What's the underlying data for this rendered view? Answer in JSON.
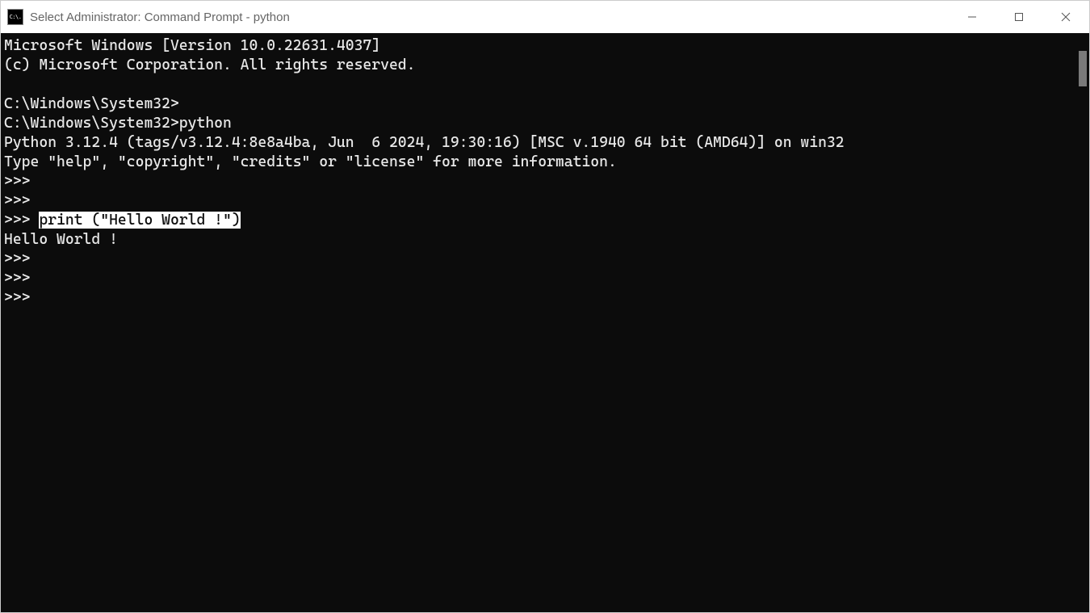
{
  "titlebar": {
    "icon_text": "C:\\.",
    "title": "Select Administrator: Command Prompt - python"
  },
  "terminal": {
    "lines": [
      {
        "text": "Microsoft Windows [Version 10.0.22631.4037]"
      },
      {
        "text": "(c) Microsoft Corporation. All rights reserved."
      },
      {
        "text": ""
      },
      {
        "text": "C:\\Windows\\System32>"
      },
      {
        "text": "C:\\Windows\\System32>python"
      },
      {
        "text": "Python 3.12.4 (tags/v3.12.4:8e8a4ba, Jun  6 2024, 19:30:16) [MSC v.1940 64 bit (AMD64)] on win32"
      },
      {
        "text": "Type \"help\", \"copyright\", \"credits\" or \"license\" for more information."
      },
      {
        "text": ">>>"
      },
      {
        "text": ">>>"
      },
      {
        "prefix": ">>> ",
        "selected": "print (\"Hello World !\")"
      },
      {
        "text": "Hello World !"
      },
      {
        "text": ">>>"
      },
      {
        "text": ">>>"
      },
      {
        "text": ">>>"
      }
    ]
  }
}
